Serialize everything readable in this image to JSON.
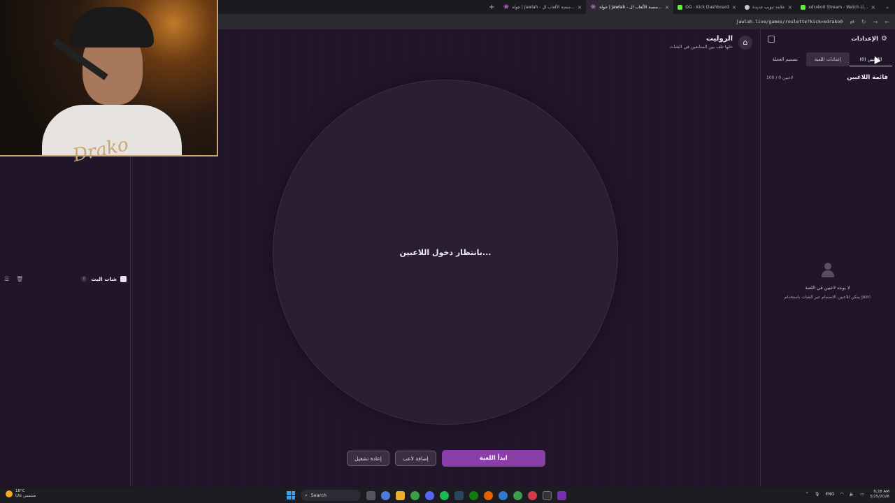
{
  "browser": {
    "tabs": [
      {
        "label": "xdrako0 Stream - Watch Li...",
        "active": false
      },
      {
        "label": "علامة تبويب جديدة",
        "active": false
      },
      {
        "label": "OG - Kick Dashboard",
        "active": false
      },
      {
        "label": "جولة | Jawlah - منصة الألعاب ال...",
        "active": true
      },
      {
        "label": "جولة | Jawlah - منصة الألعاب ال...",
        "active": false
      }
    ],
    "new_tab": "+",
    "url": "jawlah.live/games/roulette?kick=xdrako0"
  },
  "header": {
    "title": "الروليت",
    "subtitle": "خلها تلف بين المتابعين في الشات"
  },
  "wheel": {
    "waiting_text": "بانتظار دخول اللاعبين..."
  },
  "actions": {
    "restart": "إعادة تشغيل",
    "add_player": "إضافة لاعب",
    "start_game": "ابدأ اللعبة"
  },
  "chat": {
    "title": "شات البث",
    "count": "0"
  },
  "settings": {
    "title": "الإعدادات",
    "tabs": [
      "اللاعبين (0)",
      "إعدادات اللعبة",
      "تصميم العجلة"
    ],
    "list_title": "قائمة اللاعبين",
    "list_count": "100 / 0 لاعبين",
    "empty_title": "لا يوجد لاعبين في اللعبة",
    "empty_hint": "يمكن للاعبين الانضمام عبر الشات باستخدام join!"
  },
  "webcam": {
    "signature": "Drako"
  },
  "taskbar": {
    "weather_temp": "18°C",
    "weather_desc": "مشمس غالبًا",
    "search": "Search",
    "lang": "ENG",
    "time": "6:28 AM",
    "date": "3/25/2026"
  },
  "colors": {
    "accent": "#8a3ea8",
    "background": "#1f1324",
    "panel": "#21152a",
    "kick": "#53fc18"
  }
}
